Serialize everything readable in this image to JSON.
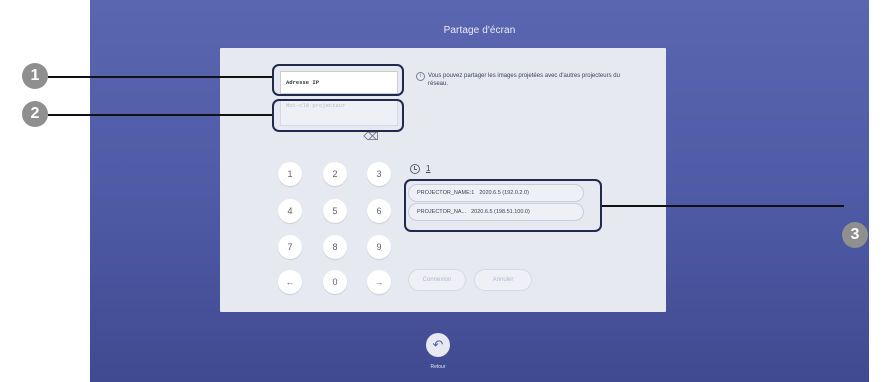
{
  "title": "Partage d'écran",
  "ip_field": {
    "value": "Adresse IP"
  },
  "keyword_field": {
    "placeholder": "Mot-clé projecteur"
  },
  "info_text": "Vous pouvez partager les images projetées avec d'autres projecteurs du réseau.",
  "keypad": {
    "keys": [
      "1",
      "2",
      "3",
      "4",
      "5",
      "6",
      "7",
      "8",
      "9",
      "0"
    ],
    "left_arrow": "←",
    "right_arrow": "→",
    "backspace": "⌫"
  },
  "history": {
    "count": "1"
  },
  "projectors": [
    {
      "name": "PROJECTOR_NAME:1",
      "version": "2020.6.5 (192.0.2.0)"
    },
    {
      "name": "PROJECTOR_NA...",
      "version": "2020.6.5 (198.51.100.0)"
    }
  ],
  "buttons": {
    "connect": "Connexion",
    "cancel": "Annuler"
  },
  "return": {
    "icon": "↶",
    "label": "Retour"
  },
  "callouts": [
    "1",
    "2",
    "3"
  ],
  "colors": {
    "background": "#4f5ba6",
    "panel": "#e7e9f1",
    "badge": "#8f8f8f"
  }
}
